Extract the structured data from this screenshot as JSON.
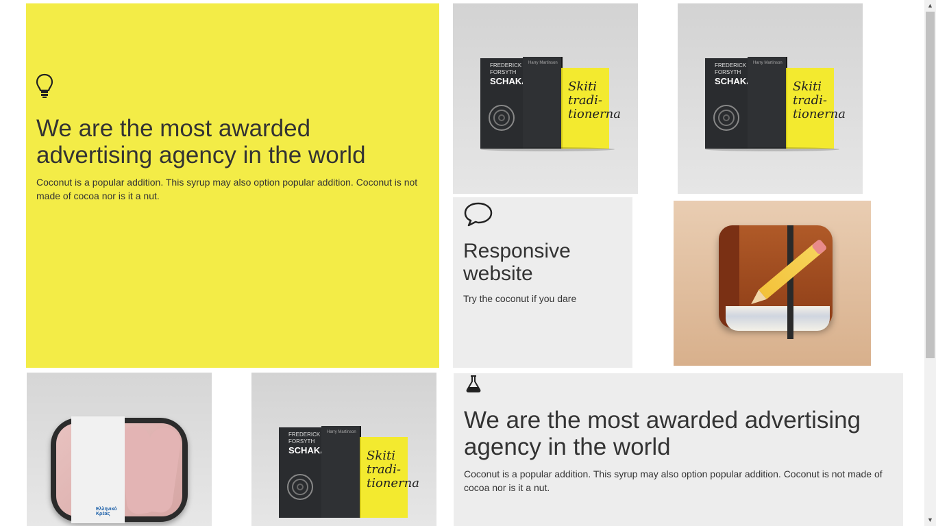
{
  "tiles": {
    "feature_main": {
      "icon": "lightbulb-icon",
      "title": "We are the most awarded advertising agency in the world",
      "body": "Coconut is a popular addition. This syrup may also option popular addition. Coconut is not made of cocoa nor is it a nut.",
      "background": "#f3ec47"
    },
    "responsive": {
      "icon": "speech-bubble-icon",
      "title_line1": "Responsive",
      "title_line2": "website",
      "body": "Try the coconut if you dare",
      "background": "#ededed"
    },
    "feature_bottom": {
      "icon": "flask-icon",
      "title": "We are the most awarded advertising agency in the world",
      "body": "Coconut is a popular addition. This syrup may also option popular addition. Coconut is not made of cocoa nor is it a nut.",
      "background": "#ededed"
    }
  },
  "book_mockup": {
    "book1_author": "FREDERICK FORSYTH",
    "book1_title": "SCHAKALEN",
    "book1_spine": "SCHAKALEN",
    "book2_author": "Harry Martinson",
    "book3_title_l1": "Skiti",
    "book3_title_l2": "tradi-",
    "book3_title_l3": "tionerna"
  },
  "tray_brand": "Ελληνικό Κρέας",
  "colors": {
    "yellow": "#f3ec47",
    "grey_tile": "#ededed",
    "text": "#333333"
  }
}
